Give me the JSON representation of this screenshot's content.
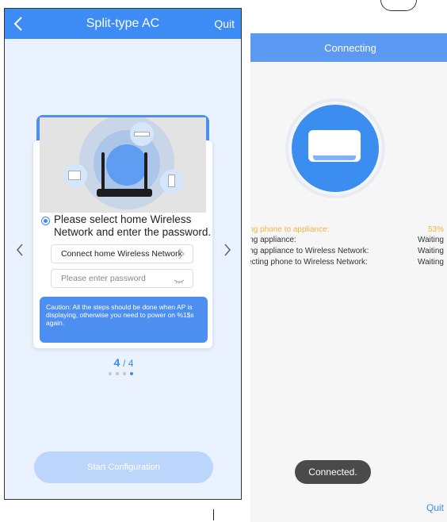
{
  "left_screen": {
    "header": {
      "title": "Split-type AC",
      "quit_label": "Quit"
    },
    "instruction": "Please select home Wireless Network and enter the password.",
    "network_field": {
      "value": "Connect home Wireless Network"
    },
    "password_field": {
      "placeholder": "Please enter password"
    },
    "caution_text": "Caution: All the steps should be done when AP is displaying, otherwise you need to power on %1$s again.",
    "pager": {
      "current": "4",
      "total": "/ 4"
    },
    "start_button_label": "Start Configuration",
    "accent_color": "#3d8bf5"
  },
  "right_screen": {
    "header": {
      "title": "Connecting"
    },
    "status_rows": [
      {
        "label": "ing phone to appliance:",
        "value": "53%",
        "color": "#f2b441"
      },
      {
        "label": "ing appliance:",
        "value": "Waiting"
      },
      {
        "label": "ing appliance to Wireless Network:",
        "value": "Waiting"
      },
      {
        "label": "ecting phone to Wireless Network:",
        "value": "Waiting"
      }
    ],
    "toast": "Connected.",
    "quit_label": "Quit"
  },
  "icons": [
    "back-chevron-icon",
    "router-icon",
    "air-conditioner-icon",
    "eye-hidden-icon",
    "chevron-right-icon"
  ]
}
